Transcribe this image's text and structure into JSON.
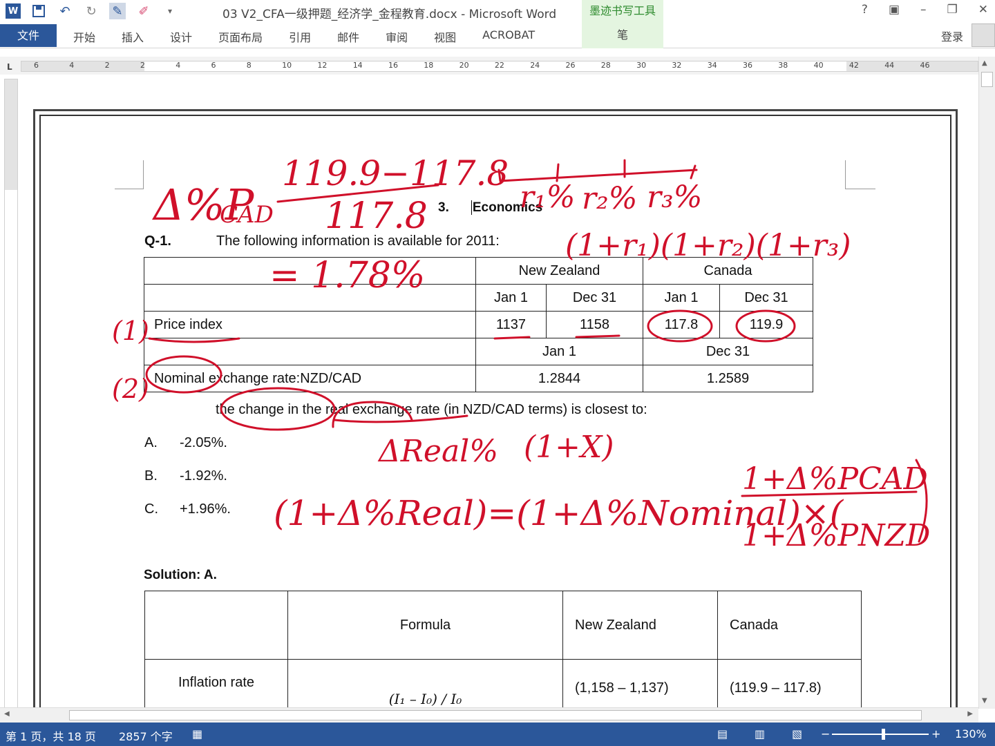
{
  "window": {
    "title": "03 V2_CFA一级押题_经济学_金程教育.docx - Microsoft Word",
    "ink_tools_tab": "墨迹书写工具",
    "help": "?",
    "minimize": "–",
    "restore": "❐",
    "close": "✕"
  },
  "ribbon": {
    "file_tab": "文件",
    "tabs": [
      "开始",
      "插入",
      "设计",
      "页面布局",
      "引用",
      "邮件",
      "审阅",
      "视图",
      "ACROBAT"
    ],
    "pen_tab": "笔",
    "login": "登录"
  },
  "ruler": {
    "marks": [
      "6",
      "4",
      "2",
      "2",
      "4",
      "6",
      "8",
      "10",
      "12",
      "14",
      "16",
      "18",
      "20",
      "22",
      "24",
      "26",
      "28",
      "30",
      "32",
      "34",
      "36",
      "38",
      "40",
      "42",
      "44",
      "46"
    ]
  },
  "document": {
    "heading_number": "3.",
    "heading_text": "Economics",
    "question_label": "Q-1.",
    "question_intro": "The following information is available for 2011:",
    "table1": {
      "country1": "New Zealand",
      "country2": "Canada",
      "dates": [
        "Jan 1",
        "Dec 31",
        "Jan 1",
        "Dec 31"
      ],
      "price_label": "Price index",
      "price_values": [
        "1137",
        "1158",
        "117.8",
        "119.9"
      ],
      "rate_dates": [
        "Jan 1",
        "Dec 31"
      ],
      "rate_label": "Nominal exchange rate:NZD/CAD",
      "rate_values": [
        "1.2844",
        "1.2589"
      ]
    },
    "question_text": "the change in the real exchange rate (in NZD/CAD terms) is closest to:",
    "options": [
      {
        "letter": "A.",
        "text": "-2.05%."
      },
      {
        "letter": "B.",
        "text": "-1.92%."
      },
      {
        "letter": "C.",
        "text": "+1.96%."
      }
    ],
    "solution": "Solution: A.",
    "table2": {
      "header": [
        "",
        "Formula",
        "New Zealand",
        "Canada"
      ],
      "row_label": "Inflation rate",
      "formula": "(I₁ – I₀) / I₀",
      "nz": "(1,158   –   1,137)",
      "ca": "(119.9   –   117.8)"
    }
  },
  "status": {
    "page": "第 1 页，共 18 页",
    "words": "2857 个字",
    "zoom": "130%"
  }
}
